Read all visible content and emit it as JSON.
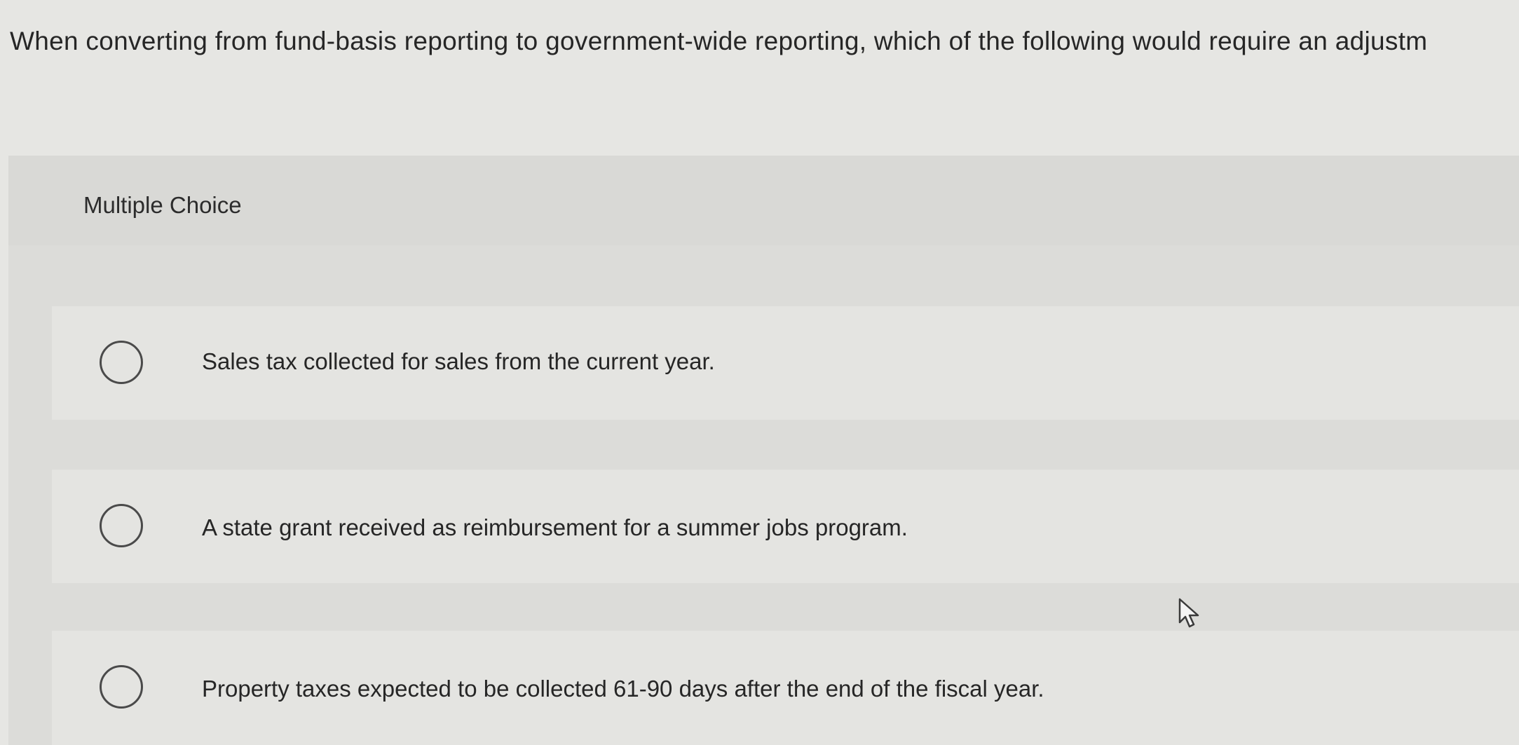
{
  "question": {
    "text": "When converting from fund-basis reporting to government-wide reporting, which of the following would require an adjustm"
  },
  "question_type": {
    "label": "Multiple Choice"
  },
  "options": [
    {
      "text": "Sales tax collected for sales from the current year.",
      "selected": false
    },
    {
      "text": "A state grant received as reimbursement for a summer jobs program.",
      "selected": false
    },
    {
      "text": "Property taxes expected to be collected 61-90 days after the end of the fiscal year.",
      "selected": false
    }
  ],
  "icons": {
    "radio": "radio-unselected-icon",
    "cursor": "mouse-pointer-icon"
  },
  "colors": {
    "background": "#e6e6e3",
    "panel": "#dcdcd9",
    "option_background": "#e4e4e1",
    "text": "#262626",
    "radio_border": "#4a4a4a"
  }
}
